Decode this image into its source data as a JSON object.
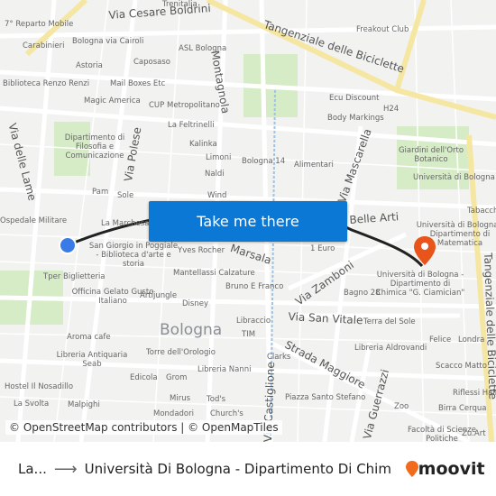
{
  "map": {
    "labels": [
      "7° Reparto Mobile",
      "Carabinieri",
      "Bologna via Cairoli",
      "Astoria",
      "Caposaso",
      "ASL Bologna",
      "Trenitalia",
      "Freakout Club",
      "Biblioteca Renzo Renzi",
      "Mail Boxes Etc",
      "Magic America",
      "CUP Metropolitano",
      "Ecu Discount",
      "H24",
      "Body Markings",
      "La Feltrinelli",
      "Dipartimento di Filosofia e Comunicazione",
      "Kalinka",
      "Limoni",
      "Naldi",
      "Bologna 14",
      "Alimentari",
      "Giardini dell'Orto Botanico",
      "Università di Bologna",
      "Pam",
      "Sole",
      "Wind",
      "Ospedale Militare",
      "La Marchesa",
      "San Giorgio in Poggiale - Biblioteca d'arte e storia",
      "Yves Rocher",
      "1 Euro",
      "Tabacchi",
      "Università di Bologna - Dipartimento di Matematica",
      "Tper Biglietteria",
      "Mantellassi Calzature",
      "Bruno E Franco",
      "Università di Bologna - Dipartimento di Chimica \"G. Ciamician\"",
      "Bagno 28",
      "Officina Gelato Gusto Italiano",
      "Artijungle",
      "Disney",
      "Libraccio",
      "Terra del Sole",
      "Aroma cafe",
      "TIM",
      "Felice",
      "Londra",
      "Libreria Antiquaria Seab",
      "Torre dell'Orologio",
      "Libreria Aldrovandi",
      "Scacco Matto",
      "Edicola",
      "Libreria Nanni",
      "Hostel Il Nosadillo",
      "Grom",
      "Clarks",
      "Riflessi Hair",
      "Mirus",
      "Tod's",
      "Piazza Santo Stefano",
      "Zoo",
      "Birra Cerqua",
      "La Svolta",
      "Mondadori",
      "Church's",
      "Facoltà di Scienze Politiche",
      "Zu.Art",
      "Malpighi"
    ],
    "streets": [
      "Via Cesare Boldrini",
      "Tangenziale delle Biciclette",
      "Montagnola",
      "Via delle Lame",
      "Via Polese",
      "Via Mascarella",
      "Belle Arti",
      "Marsala",
      "Via Zamboni",
      "Via San Vitale",
      "Strada Maggiore",
      "Via Castiglione",
      "Via Guerrazzi",
      "Tangenziale delle Biciclette"
    ],
    "city": "Bologna",
    "cta_label": "Take me there",
    "attribution": "© OpenStreetMap contributors | © OpenMapTiles",
    "origin_color": "#3b7be8",
    "destination_color": "#e8541a",
    "route_color": "#222222"
  },
  "footer": {
    "from": "La...",
    "arrow_icon": "arrow-right-icon",
    "to": "Università Di Bologna - Dipartimento Di Chimi...",
    "logo": "moovit"
  }
}
